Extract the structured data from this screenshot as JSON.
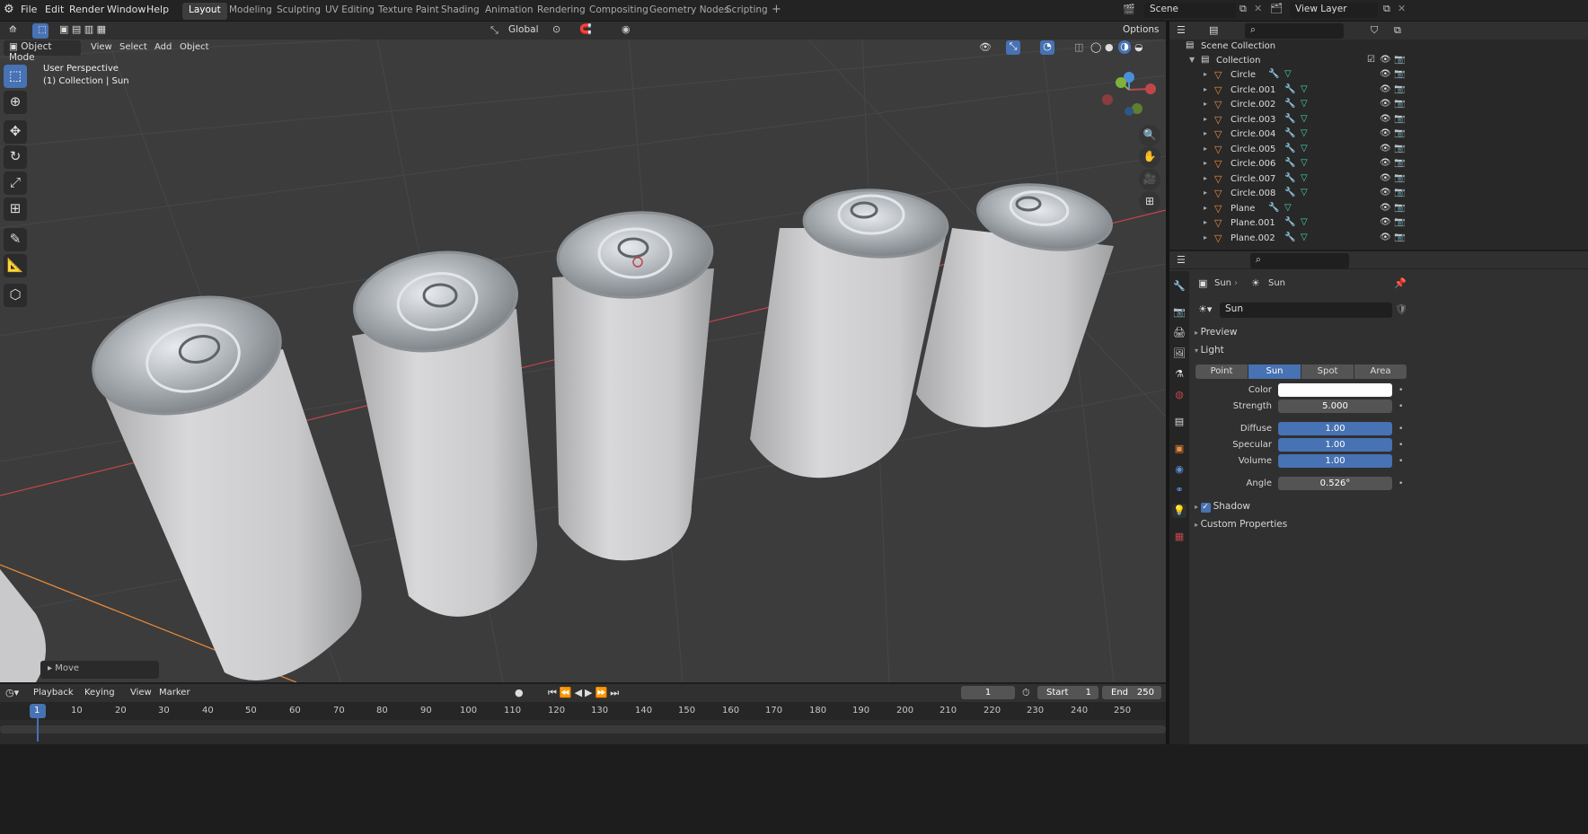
{
  "topbar": {
    "menus": [
      "File",
      "Edit",
      "Render",
      "Window",
      "Help"
    ],
    "workspaces": [
      "Layout",
      "Modeling",
      "Sculpting",
      "UV Editing",
      "Texture Paint",
      "Shading",
      "Animation",
      "Rendering",
      "Compositing",
      "Geometry Nodes",
      "Scripting"
    ],
    "active_workspace": "Layout",
    "add_tab": "+",
    "scene": "Scene",
    "view_layer": "View Layer"
  },
  "toolheader": {
    "orientation": "Global",
    "options": "Options"
  },
  "viewport_header": {
    "mode": "Object Mode",
    "menus": [
      "View",
      "Select",
      "Add",
      "Object"
    ]
  },
  "viewport": {
    "perspective": "User Perspective",
    "collection": "(1) Collection | Sun",
    "last_op": "Move",
    "gizmo": {
      "x": "X",
      "y": "Y",
      "z": "Z"
    }
  },
  "outliner": {
    "scene_collection": "Scene Collection",
    "collection": "Collection",
    "items": [
      {
        "name": "Circle"
      },
      {
        "name": "Circle.001"
      },
      {
        "name": "Circle.002"
      },
      {
        "name": "Circle.003"
      },
      {
        "name": "Circle.004"
      },
      {
        "name": "Circle.005"
      },
      {
        "name": "Circle.006"
      },
      {
        "name": "Circle.007"
      },
      {
        "name": "Circle.008"
      },
      {
        "name": "Plane"
      },
      {
        "name": "Plane.001"
      },
      {
        "name": "Plane.002"
      }
    ]
  },
  "properties": {
    "breadcrumb_object": "Sun",
    "breadcrumb_data": "Sun",
    "datablock": "Sun",
    "panels": {
      "preview": "Preview",
      "light": "Light",
      "shadow": "Shadow",
      "custom": "Custom Properties"
    },
    "light_types": [
      "Point",
      "Sun",
      "Spot",
      "Area"
    ],
    "active_light_type": "Sun",
    "color_label": "Color",
    "color_value": "#ffffff",
    "strength_label": "Strength",
    "strength_value": "5.000",
    "diffuse_label": "Diffuse",
    "diffuse_value": "1.00",
    "specular_label": "Specular",
    "specular_value": "1.00",
    "volume_label": "Volume",
    "volume_value": "1.00",
    "angle_label": "Angle",
    "angle_value": "0.526°",
    "shadow_checked": true
  },
  "timeline": {
    "menus": [
      "Playback",
      "Keying",
      "View",
      "Marker"
    ],
    "current_frame": "1",
    "start_label": "Start",
    "start_value": "1",
    "end_label": "End",
    "end_value": "250",
    "ruler": [
      "1",
      "10",
      "20",
      "30",
      "40",
      "50",
      "60",
      "70",
      "80",
      "90",
      "100",
      "110",
      "120",
      "130",
      "140",
      "150",
      "160",
      "170",
      "180",
      "190",
      "200",
      "210",
      "220",
      "230",
      "240",
      "250"
    ]
  },
  "colors": {
    "accent": "#4772b3",
    "viewport_bg": "#3c3c3c",
    "x_axis": "#c0464a",
    "selection_orange": "#f08d3c"
  }
}
